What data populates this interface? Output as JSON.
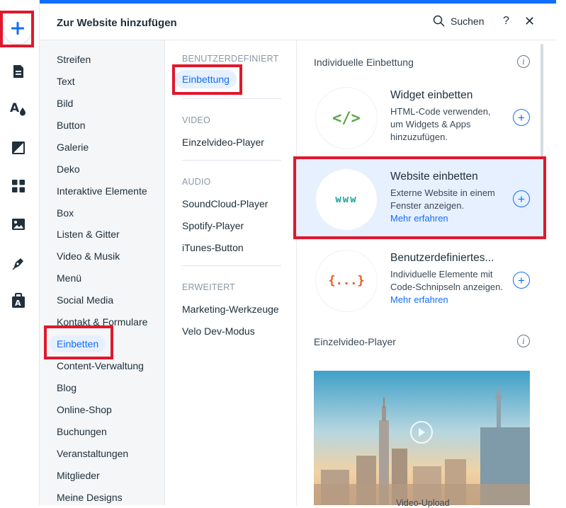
{
  "leftbar": {
    "icons": [
      "add-icon",
      "page-icon",
      "theme-icon",
      "background-icon",
      "apps-icon",
      "media-icon",
      "pen-icon",
      "portfolio-icon"
    ]
  },
  "header": {
    "title": "Zur Website hinzufügen",
    "search_label": "Suchen",
    "help_label": "?",
    "close_label": "✕"
  },
  "categories": [
    "Streifen",
    "Text",
    "Bild",
    "Button",
    "Galerie",
    "Deko",
    "Interaktive Elemente",
    "Box",
    "Listen & Gitter",
    "Video & Musik",
    "Menü",
    "Social Media",
    "Kontakt & Formulare",
    "Einbetten",
    "Content-Verwaltung",
    "Blog",
    "Online-Shop",
    "Buchungen",
    "Veranstaltungen",
    "Mitglieder",
    "Meine Designs"
  ],
  "active_category": "Einbetten",
  "subcategories": {
    "sections": [
      {
        "title": "BENUTZERDEFINIERT",
        "items": [
          "Einbettung"
        ]
      },
      {
        "title": "VIDEO",
        "items": [
          "Einzelvideo-Player"
        ]
      },
      {
        "title": "AUDIO",
        "items": [
          "SoundCloud-Player",
          "Spotify-Player",
          "iTunes-Button"
        ]
      },
      {
        "title": "ERWEITERT",
        "items": [
          "Marketing-Werkzeuge",
          "Velo Dev-Modus"
        ]
      }
    ],
    "active": "Einbettung"
  },
  "content": {
    "section1_title": "Individuelle Einbettung",
    "section2_title": "Einzelvideo-Player",
    "info_glyph": "i",
    "plus_glyph": "+",
    "cards": [
      {
        "icon_text": "</>",
        "title": "Widget einbetten",
        "desc": "HTML-Code verwenden, um Widgets & Apps hinzuzufügen.",
        "link": ""
      },
      {
        "icon_text": "www",
        "title": "Website einbetten",
        "desc": "Externe Website in einem Fenster anzeigen.",
        "link": "Mehr erfahren"
      },
      {
        "icon_text": "{...}",
        "title": "Benutzerdefiniertes...",
        "desc": "Individuelle Elemente mit Code-Schnipseln anzeigen.",
        "link": "Mehr erfahren"
      }
    ],
    "video_caption": "Video-Upload"
  },
  "colors": {
    "accent": "#116dff",
    "highlight_bg": "#e7f0ff",
    "annotation_red": "#e0182d",
    "widget_icon_green": "#5aa846",
    "www_teal": "#1aa69a",
    "custom_icon_orange": "#ea5a1f"
  }
}
